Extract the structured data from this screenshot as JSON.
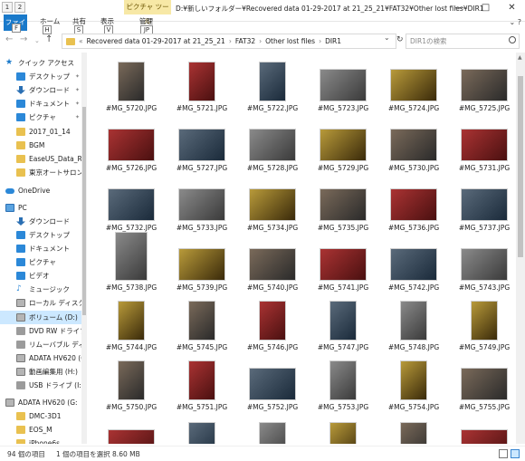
{
  "titlebar": {
    "context_tab": "ピクチャ ツール",
    "title": "D:¥新しいフォルダー¥Recovered data 01-29-2017 at 21_25_21¥FAT32¥Other lost files¥DIR1",
    "qat_keys": [
      "1",
      "2"
    ],
    "window_buttons": [
      "—",
      "□",
      "✕"
    ]
  },
  "ribbon": {
    "tabs": [
      {
        "label": "ファイル",
        "key": "F"
      },
      {
        "label": "ホーム",
        "key": "H"
      },
      {
        "label": "共有",
        "key": "S"
      },
      {
        "label": "表示",
        "key": "V"
      },
      {
        "label": "管理",
        "key": "JP"
      }
    ]
  },
  "address": {
    "segments": [
      "Recovered data 01-29-2017 at 21_25_21",
      "FAT32",
      "Other lost files",
      "DIR1"
    ],
    "search_placeholder": "DIR1の検索"
  },
  "navpane": {
    "items": [
      {
        "label": "クイック アクセス",
        "icon": "star-icon"
      },
      {
        "label": "デスクトップ",
        "icon": "desktop-icon",
        "pinned": true
      },
      {
        "label": "ダウンロード",
        "icon": "download-icon",
        "pinned": true
      },
      {
        "label": "ドキュメント",
        "icon": "documents-icon",
        "pinned": true
      },
      {
        "label": "ピクチャ",
        "icon": "pictures-icon",
        "pinned": true
      },
      {
        "label": "2017_01_14",
        "icon": "folder-icon"
      },
      {
        "label": "BGM",
        "icon": "folder-icon"
      },
      {
        "label": "EaseUS_Data_Re",
        "icon": "folder-icon"
      },
      {
        "label": "東京オートサロン20",
        "icon": "folder-icon"
      },
      {
        "label": "OneDrive",
        "icon": "onedrive-icon"
      },
      {
        "label": "PC",
        "icon": "pc-icon"
      },
      {
        "label": "ダウンロード",
        "icon": "download-icon"
      },
      {
        "label": "デスクトップ",
        "icon": "desktop-icon"
      },
      {
        "label": "ドキュメント",
        "icon": "documents-icon"
      },
      {
        "label": "ピクチャ",
        "icon": "pictures-icon"
      },
      {
        "label": "ビデオ",
        "icon": "video-icon"
      },
      {
        "label": "ミュージック",
        "icon": "music-icon"
      },
      {
        "label": "ローカル ディスク (C",
        "icon": "drive-icon"
      },
      {
        "label": "ボリューム (D:)",
        "icon": "drive-icon"
      },
      {
        "label": "DVD RW ドライブ (",
        "icon": "dvd-icon"
      },
      {
        "label": "リムーバブル ディスク",
        "icon": "removable-icon"
      },
      {
        "label": "ADATA HV620 (G",
        "icon": "drive-icon"
      },
      {
        "label": "動画編集用 (H:)",
        "icon": "drive-icon"
      },
      {
        "label": "USB ドライブ (I:)",
        "icon": "usb-icon"
      },
      {
        "label": "ADATA HV620 (G:",
        "icon": "drive-icon"
      },
      {
        "label": "DMC-3D1",
        "icon": "folder-icon"
      },
      {
        "label": "EOS_M",
        "icon": "folder-icon"
      },
      {
        "label": "iPhone6s",
        "icon": "folder-icon"
      }
    ]
  },
  "files": [
    "#MG_5720.JPG",
    "#MG_5721.JPG",
    "#MG_5722.JPG",
    "#MG_5723.JPG",
    "#MG_5724.JPG",
    "#MG_5725.JPG",
    "#MG_5726.JPG",
    "#MG_5727.JPG",
    "#MG_5728.JPG",
    "#MG_5729.JPG",
    "#MG_5730.JPG",
    "#MG_5731.JPG",
    "#MG_5732.JPG",
    "#MG_5733.JPG",
    "#MG_5734.JPG",
    "#MG_5735.JPG",
    "#MG_5736.JPG",
    "#MG_5737.JPG",
    "#MG_5738.JPG",
    "#MG_5739.JPG",
    "#MG_5740.JPG",
    "#MG_5741.JPG",
    "#MG_5742.JPG",
    "#MG_5743.JPG",
    "#MG_5744.JPG",
    "#MG_5745.JPG",
    "#MG_5746.JPG",
    "#MG_5747.JPG",
    "#MG_5748.JPG",
    "#MG_5749.JPG",
    "#MG_5750.JPG",
    "#MG_5751.JPG",
    "#MG_5752.JPG",
    "#MG_5753.JPG",
    "#MG_5754.JPG",
    "#MG_5755.JPG",
    "",
    "",
    "",
    "",
    "",
    ""
  ],
  "status": {
    "count": "94 個の項目",
    "selection": "1 個の項目を選択  8.60 MB"
  }
}
